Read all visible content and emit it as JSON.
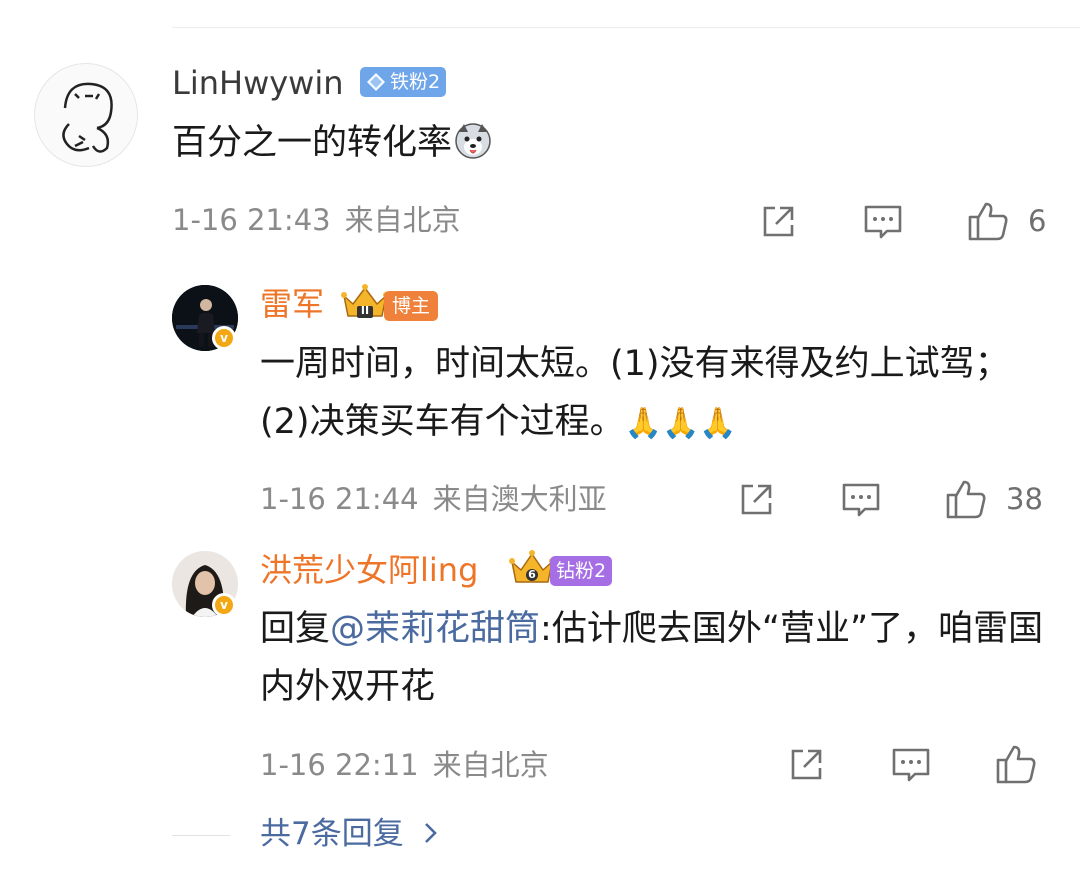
{
  "comment": {
    "username": "LinHwywin",
    "badge": "铁粉2",
    "text": "百分之一的转化率",
    "emoji": "husky-emoji",
    "date": "1-16 21:43",
    "location": "来自北京",
    "likes": "6"
  },
  "replies": [
    {
      "username": "雷军",
      "badge": "博主",
      "badge_level": "II",
      "text": "一周时间，时间太短。(1)没有来得及约上试驾；(2)决策买车有个过程。",
      "emoji": "🙏🙏🙏",
      "date": "1-16 21:44",
      "location": "来自澳大利亚",
      "likes": "38"
    },
    {
      "username": "洪荒少女阿ling",
      "badge": "钻粉2",
      "badge_level": "6",
      "reply_prefix": "回复",
      "mention": "@茉莉花甜筒",
      "text": ":估计爬去国外“营业”了，咱雷国内外双开花",
      "date": "1-16 22:11",
      "location": "来自北京",
      "likes": ""
    }
  ],
  "more_replies": "共7条回复",
  "colors": {
    "orange_name": "#ee7528",
    "purple_badge": "#a66ee5",
    "blue_badge": "#6fa6ea",
    "link": "#4a6aa0",
    "meta_gray": "#8a8a8a"
  }
}
